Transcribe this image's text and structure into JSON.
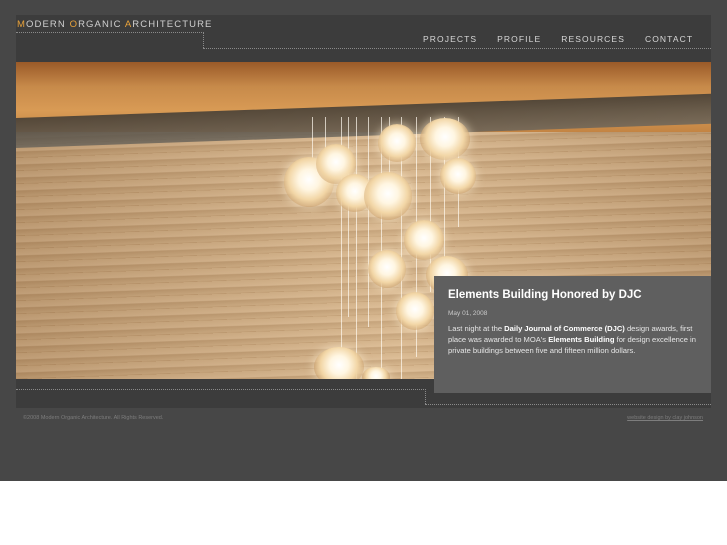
{
  "site": {
    "logo_parts": [
      {
        "initial": "M",
        "rest": "ODERN "
      },
      {
        "initial": "O",
        "rest": "RGANIC "
      },
      {
        "initial": "A",
        "rest": "RCHITECTURE"
      }
    ]
  },
  "nav": {
    "items": [
      {
        "label": "PROJECTS"
      },
      {
        "label": "PROFILE"
      },
      {
        "label": "RESOURCES"
      },
      {
        "label": "CONTACT"
      }
    ]
  },
  "news": {
    "title": "Elements Building Honored by DJC",
    "date": "May 01, 2008",
    "body_1": "Last night at the ",
    "body_bold_1": "Daily Journal of Commerce (DJC)",
    "body_2": " design awards, first place was awarded to MOA's ",
    "body_bold_2": "Elements Building",
    "body_3": " for design excellence in private buildings between five and fifteen million dollars."
  },
  "footer": {
    "copyright": "©2008 Modern Organic Architecture. All Rights Reserved.",
    "credit": "website design by clay johnson"
  },
  "colors": {
    "accent": "#e8a23a",
    "background": "#474747",
    "panel": "#5f5f5f"
  }
}
